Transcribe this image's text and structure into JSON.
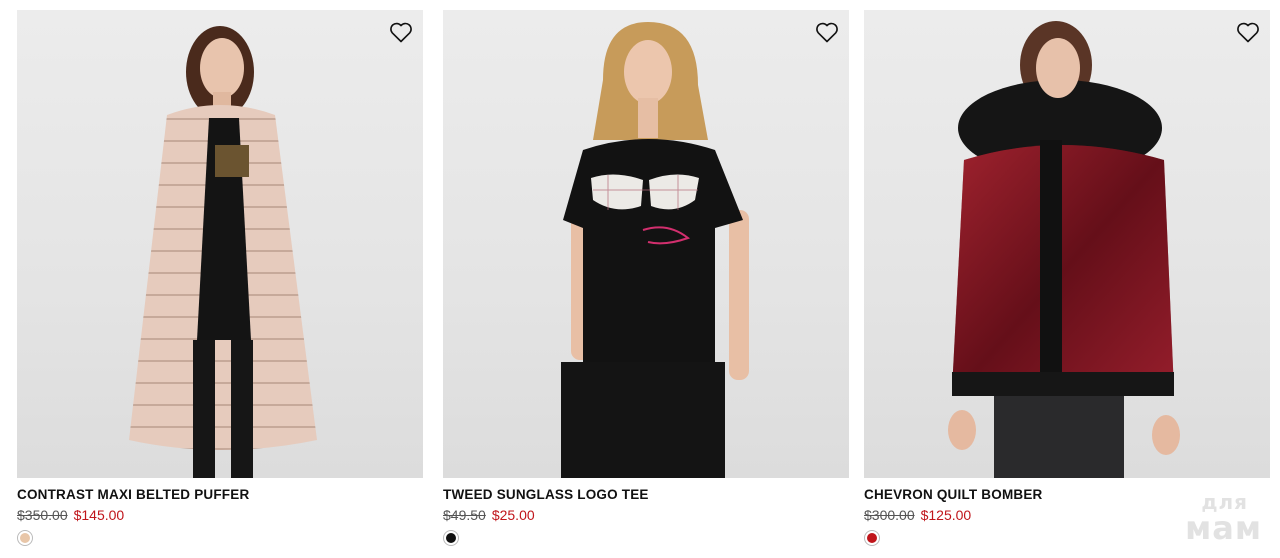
{
  "products": [
    {
      "name": "CONTRAST MAXI BELTED PUFFER",
      "price_original": "$350.00",
      "price_sale": "$145.00",
      "swatch_color": "#e8c6a8",
      "image_desc_colors": {
        "garment": "#e3c8b8",
        "inner": "#151515"
      }
    },
    {
      "name": "TWEED SUNGLASS LOGO TEE",
      "price_original": "$49.50",
      "price_sale": "$25.00",
      "swatch_color": "#111111",
      "image_desc_colors": {
        "garment": "#111111",
        "inner": "#111111"
      }
    },
    {
      "name": "CHEVRON QUILT BOMBER",
      "price_original": "$300.00",
      "price_sale": "$125.00",
      "swatch_color": "#c0151b",
      "image_desc_colors": {
        "garment": "#7e1420",
        "inner": "#111111"
      }
    }
  ],
  "watermark": {
    "top": "для",
    "bottom": "мам"
  },
  "icons": {
    "wishlist": "heart-outline-icon"
  },
  "colors": {
    "sale": "#c0151b",
    "text": "#111111"
  }
}
